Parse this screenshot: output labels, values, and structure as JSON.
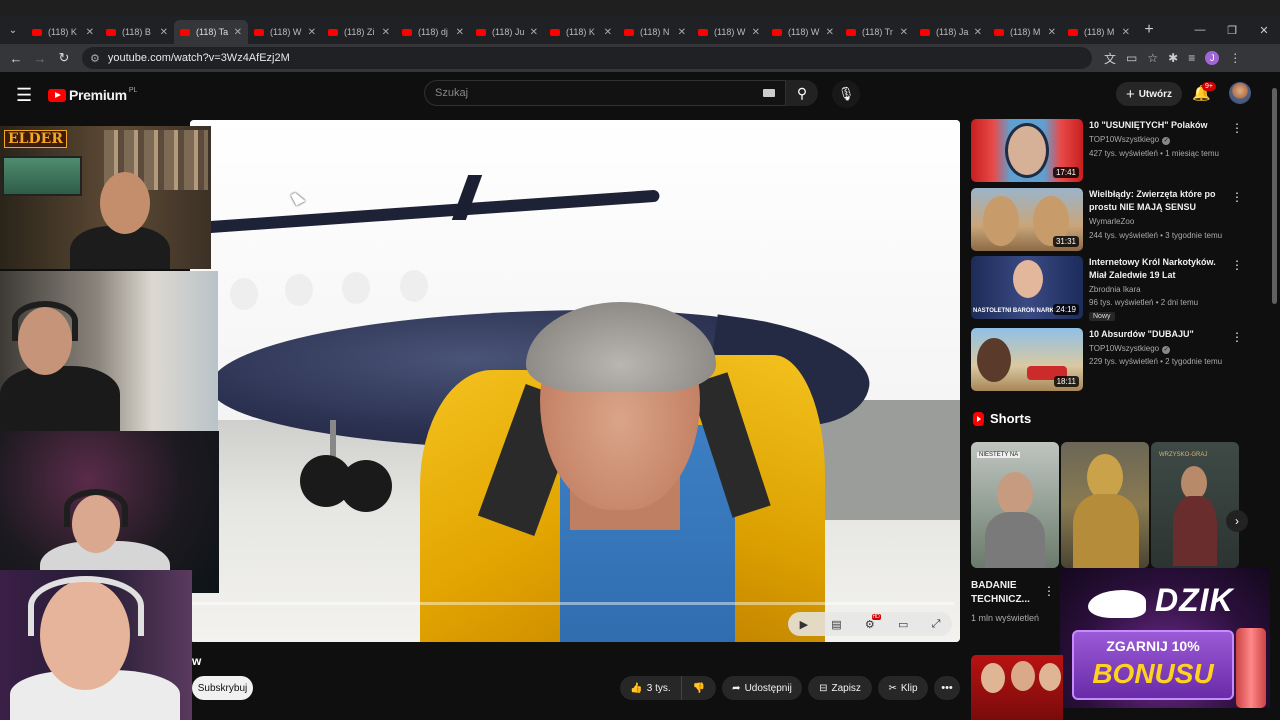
{
  "browser": {
    "tabs": [
      {
        "label": "(118) K"
      },
      {
        "label": "(118) B"
      },
      {
        "label": "(118) Ta"
      },
      {
        "label": "(118) W"
      },
      {
        "label": "(118) Zi"
      },
      {
        "label": "(118) dj"
      },
      {
        "label": "(118) Ju"
      },
      {
        "label": "(118) K"
      },
      {
        "label": "(118) N"
      },
      {
        "label": "(118) W"
      },
      {
        "label": "(118) W"
      },
      {
        "label": "(118) Tr"
      },
      {
        "label": "(118) Ja"
      },
      {
        "label": "(118) M"
      },
      {
        "label": "(118) M"
      }
    ],
    "active_tab_index": 2,
    "url": "youtube.com/watch?v=3Wz4AfEzj2M",
    "profile_initial": "J"
  },
  "header": {
    "logo_text": "Premium",
    "logo_region": "PL",
    "search_placeholder": "Szukaj",
    "create_label": "Utwórz",
    "notification_count": "9+"
  },
  "streamer_overlay": {
    "tag": "ELDER"
  },
  "video": {
    "progress": 0.0,
    "title_tail": "w"
  },
  "actions": {
    "subscribe": "Subskrybuj",
    "likes": "3 tys.",
    "share": "Udostępnij",
    "save": "Zapisz",
    "clip": "Klip",
    "more": "•••"
  },
  "recommendations": [
    {
      "title": "10 \"USUNIĘTYCH\" Polaków",
      "channel": "TOP10Wszystkiego",
      "verified": true,
      "meta": "427 tys. wyświetleń • 1 miesiąc temu",
      "duration": "17:41",
      "badge": ""
    },
    {
      "title": "Wielbłądy: Zwierzęta które po prostu NIE MAJĄ SENSU",
      "channel": "WymarleZoo",
      "verified": false,
      "meta": "244 tys. wyświetleń • 3 tygodnie temu",
      "duration": "31:31",
      "badge": ""
    },
    {
      "title": "Internetowy Król Narkotyków. Miał Zaledwie 19 Lat",
      "channel": "Zbrodnia Ikara",
      "verified": false,
      "meta": "96 tys. wyświetleń • 2 dni temu",
      "duration": "24:19",
      "badge": "Nowy",
      "thumb_caption": "NASTOLETNI BARON NARKO"
    },
    {
      "title": "10 Absurdów \"DUBAJU\"",
      "channel": "TOP10Wszystkiego",
      "verified": true,
      "meta": "229 tys. wyświetleń • 2 tygodnie temu",
      "duration": "18:11",
      "badge": ""
    }
  ],
  "shorts": {
    "section_label": "Shorts",
    "items": [
      {
        "title": "BADANIE TECHNICZ...",
        "views": "1 mln wyświetleń",
        "caption": "NIESTETY NA"
      },
      {
        "title": "",
        "views": "",
        "caption": ""
      },
      {
        "title": "",
        "views": "",
        "caption": "WRZYSKO-GRAJ"
      }
    ]
  },
  "ad": {
    "brand": "DZIK",
    "line1": "ZGARNIJ 10%",
    "line2": "BONUSU"
  },
  "colors": {
    "youtube_red": "#ff0000",
    "background": "#0f0f0f",
    "chip": "#272727"
  },
  "icons": [
    "menu-icon",
    "search-icon",
    "mic-icon",
    "plus-icon",
    "bell-icon",
    "like-icon",
    "dislike-icon",
    "share-icon",
    "save-icon",
    "clip-icon",
    "kebab-icon",
    "chevron-right-icon"
  ]
}
